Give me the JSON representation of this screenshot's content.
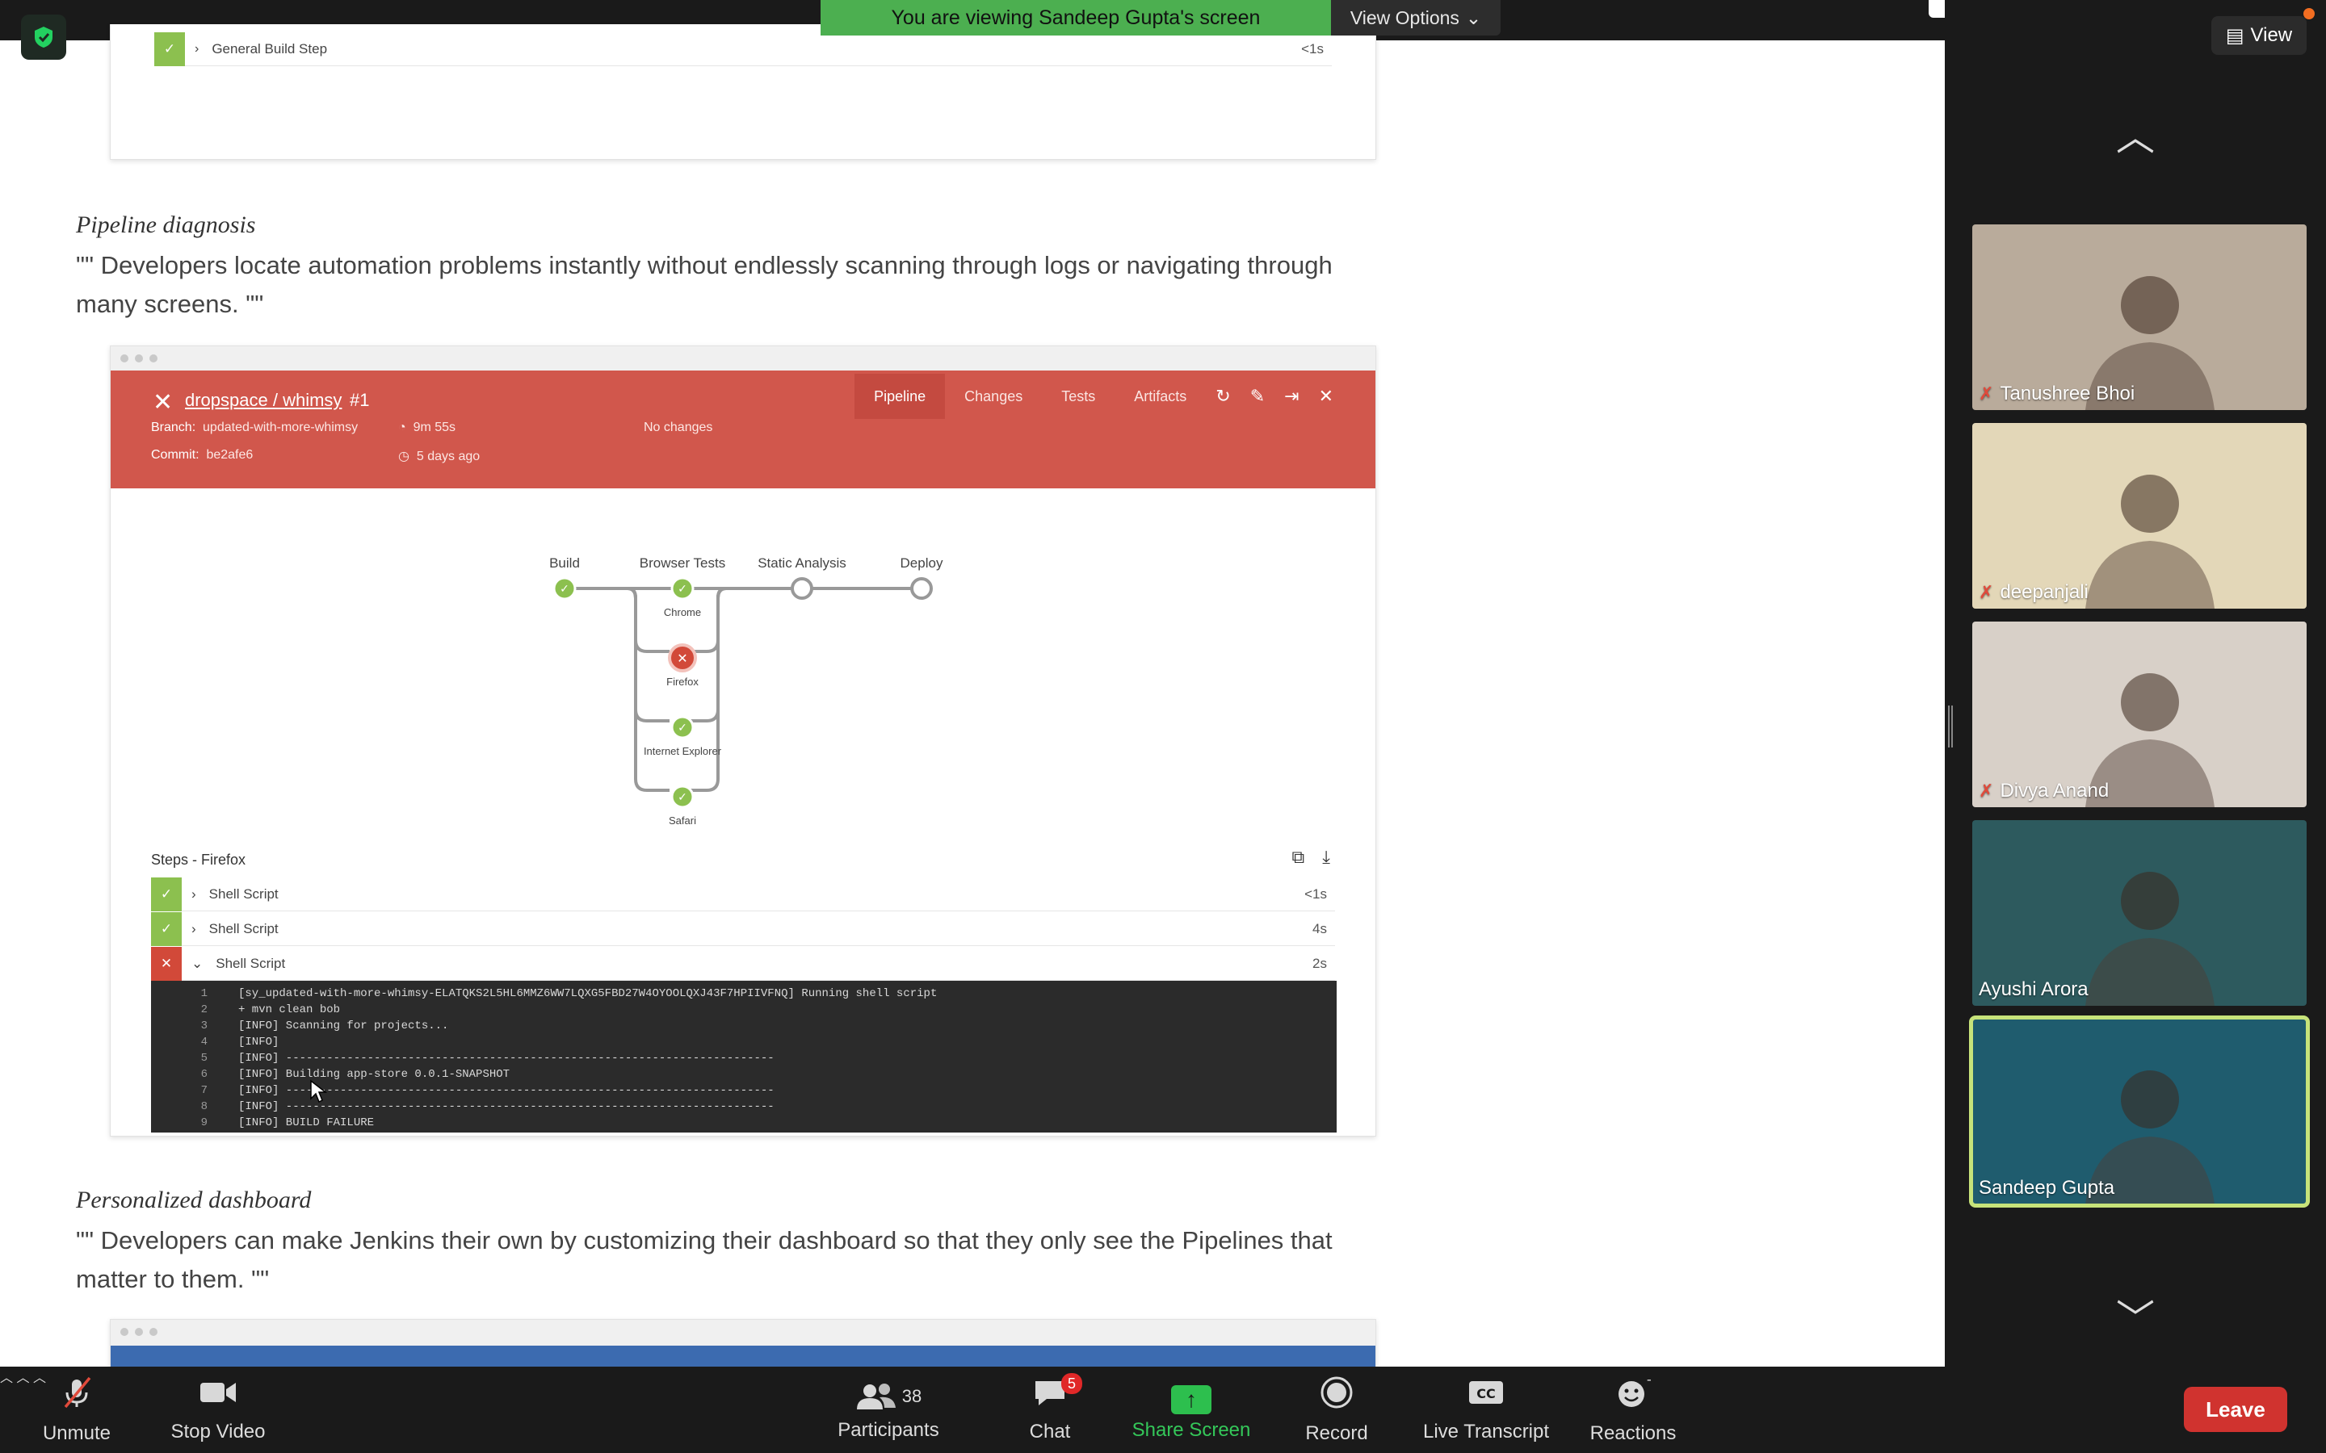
{
  "meeting": {
    "viewing_banner": "You are viewing Sandeep Gupta's screen",
    "view_options": "View Options",
    "gallery_view": "View"
  },
  "shared_page": {
    "top_card": {
      "step_label": "General Build Step",
      "step_time": "<1s"
    },
    "pipeline_section": {
      "title": "Pipeline diagnosis",
      "body": "\"\" Developers locate automation problems instantly without endlessly scanning through logs or navigating through many screens. \"\""
    },
    "dashboard_section": {
      "title": "Personalized dashboard",
      "body": "\"\" Developers can make Jenkins their own by customizing their dashboard so that they only see the Pipelines that matter to them. \"\""
    },
    "jenkins": {
      "run_title": "dropspace / whimsy",
      "run_number": "#1",
      "tabs": [
        "Pipeline",
        "Changes",
        "Tests",
        "Artifacts"
      ],
      "branch_label": "Branch:",
      "branch_value": "updated-with-more-whimsy",
      "commit_label": "Commit:",
      "commit_value": "be2afe6",
      "duration": "9m 55s",
      "age": "5 days ago",
      "changes": "No changes",
      "stages": [
        "Build",
        "Browser Tests",
        "Static Analysis",
        "Deploy"
      ],
      "parallel": [
        "Chrome",
        "Firefox",
        "Internet Explorer",
        "Safari"
      ],
      "steps_title": "Steps - Firefox",
      "steps": [
        {
          "label": "Shell Script",
          "time": "<1s",
          "status": "ok"
        },
        {
          "label": "Shell Script",
          "time": "4s",
          "status": "ok"
        },
        {
          "label": "Shell Script",
          "time": "2s",
          "status": "fail"
        }
      ],
      "console": [
        {
          "n": "1",
          "t": "[sy_updated-with-more-whimsy-ELATQKS2L5HL6MMZ6WW7LQXG5FBD27W4OYOOLQXJ43F7HPIIVFNQ] Running shell script"
        },
        {
          "n": "2",
          "t": "+ mvn clean bob"
        },
        {
          "n": "3",
          "t": "[INFO] Scanning for projects..."
        },
        {
          "n": "4",
          "t": "[INFO]"
        },
        {
          "n": "5",
          "t": "[INFO] ------------------------------------------------------------------------"
        },
        {
          "n": "6",
          "t": "[INFO] Building app-store 0.0.1-SNAPSHOT"
        },
        {
          "n": "7",
          "t": "[INFO] ------------------------------------------------------------------------"
        },
        {
          "n": "8",
          "t": "[INFO] ------------------------------------------------------------------------"
        },
        {
          "n": "9",
          "t": "[INFO] BUILD FAILURE"
        }
      ]
    }
  },
  "participants_gallery": [
    {
      "name": "Tanushree Bhoi",
      "muted": true,
      "bg": "#b9ab9b"
    },
    {
      "name": "deepanjali",
      "muted": true,
      "bg": "#e3d7b8"
    },
    {
      "name": "Divya Anand",
      "muted": true,
      "bg": "#d8d0c8"
    },
    {
      "name": "Ayushi Arora",
      "muted": false,
      "bg": "#2d5a5e"
    },
    {
      "name": "Sandeep Gupta",
      "muted": false,
      "bg": "#1f5c6e"
    }
  ],
  "toolbar": {
    "unmute": "Unmute",
    "stop_video": "Stop Video",
    "participants": "Participants",
    "participants_count": "38",
    "chat": "Chat",
    "chat_badge": "5",
    "share_screen": "Share Screen",
    "record": "Record",
    "live_transcript": "Live Transcript",
    "reactions": "Reactions",
    "leave": "Leave"
  }
}
